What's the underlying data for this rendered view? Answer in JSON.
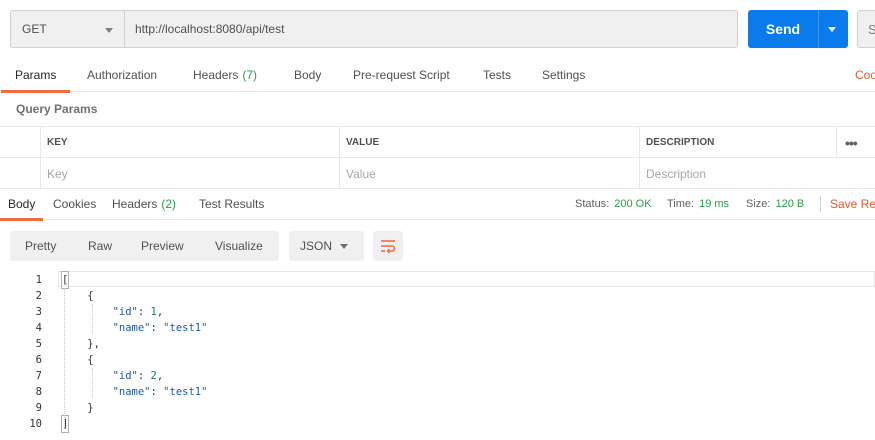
{
  "request": {
    "method": "GET",
    "url": "http://localhost:8080/api/test",
    "send_label": "Send",
    "save_label": "S"
  },
  "request_tabs": {
    "params": "Params",
    "authorization": "Authorization",
    "headers": "Headers",
    "headers_count": "(7)",
    "body": "Body",
    "prerequest": "Pre-request Script",
    "tests": "Tests",
    "settings": "Settings",
    "code": "Coo"
  },
  "query_params": {
    "title": "Query Params",
    "headers": {
      "key": "KEY",
      "value": "VALUE",
      "description": "DESCRIPTION"
    },
    "placeholders": {
      "key": "Key",
      "value": "Value",
      "description": "Description"
    },
    "more": "•••"
  },
  "response_tabs": {
    "body": "Body",
    "cookies": "Cookies",
    "headers": "Headers",
    "headers_count": "(2)",
    "test_results": "Test Results"
  },
  "response_meta": {
    "status_label": "Status:",
    "status_value": "200 OK",
    "time_label": "Time:",
    "time_value": "19 ms",
    "size_label": "Size:",
    "size_value": "120 B",
    "save_response": "Save Res"
  },
  "response_toolbar": {
    "pretty": "Pretty",
    "raw": "Raw",
    "preview": "Preview",
    "visualize": "Visualize",
    "format": "JSON"
  },
  "code": {
    "line_numbers": [
      "1",
      "2",
      "3",
      "4",
      "5",
      "6",
      "7",
      "8",
      "9",
      "10"
    ],
    "lines": [
      "[",
      "    {",
      "        \"id\": 1,",
      "        \"name\": \"test1\"",
      "    },",
      "    {",
      "        \"id\": 2,",
      "        \"name\": \"test1\"",
      "    }",
      "]"
    ]
  },
  "colors": {
    "accent": "#f26b3a",
    "send_button": "#097bed",
    "success": "#2a9d4a",
    "json_key": "#1f5b99",
    "json_number": "#098658"
  }
}
